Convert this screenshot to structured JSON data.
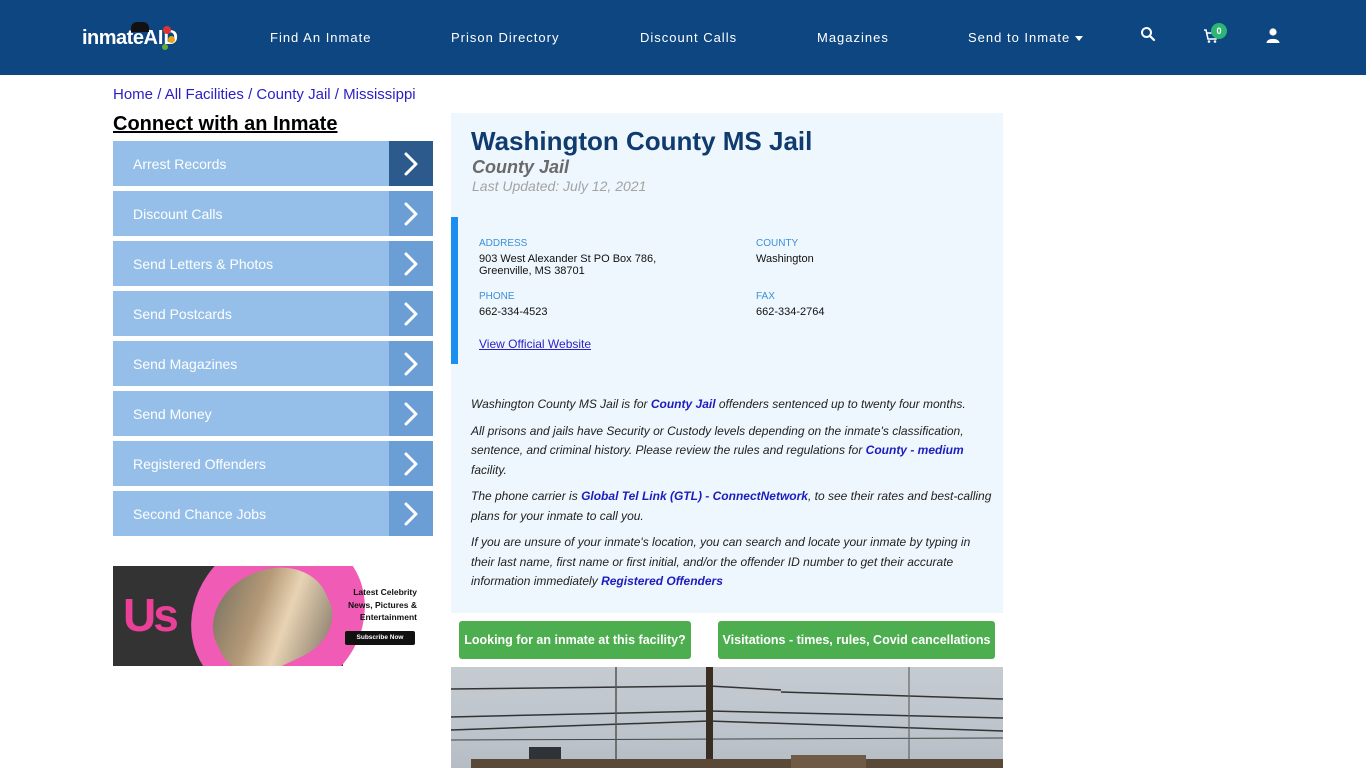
{
  "header": {
    "logo_text": "inmate",
    "logo_aid": "AID",
    "nav": [
      {
        "label": "Find An Inmate"
      },
      {
        "label": "Prison Directory"
      },
      {
        "label": "Discount Calls"
      },
      {
        "label": "Magazines"
      },
      {
        "label": "Send to Inmate",
        "dropdown": true
      }
    ],
    "icons": [
      "search-icon",
      "cart-icon",
      "user-icon"
    ],
    "cart_count": "0"
  },
  "breadcrumb": {
    "items": [
      "Home",
      "All Facilities",
      "County Jail",
      "Mississippi"
    ],
    "separator": "/"
  },
  "sidebar": {
    "title": "Connect with an Inmate",
    "items": [
      {
        "label": "Arrest Records"
      },
      {
        "label": "Discount Calls"
      },
      {
        "label": "Send Letters & Photos"
      },
      {
        "label": "Send Postcards"
      },
      {
        "label": "Send Magazines"
      },
      {
        "label": "Send Money"
      },
      {
        "label": "Registered Offenders"
      },
      {
        "label": "Second Chance Jobs"
      }
    ],
    "ad": {
      "brand": "Us",
      "line1": "Latest Celebrity",
      "line2": "News, Pictures &",
      "line3": "Entertainment",
      "button": "Subscribe Now"
    }
  },
  "facility": {
    "name": "Washington County MS Jail",
    "type": "County Jail",
    "last_updated": "Last Updated: July 12, 2021",
    "address_label": "ADDRESS",
    "address_line1": "903 West Alexander St PO Box 786,",
    "address_line2": "Greenville, MS 38701",
    "county_label": "COUNTY",
    "county": "Washington",
    "phone_label": "PHONE",
    "phone": "662-334-4523",
    "fax_label": "FAX",
    "fax": "662-334-2764",
    "website_link": "View Official Website"
  },
  "description": {
    "p1_pre": "Washington County MS Jail is for ",
    "p1_link": "County Jail",
    "p1_post": " offenders sentenced up to twenty four months.",
    "p2_pre": "All prisons and jails have Security or Custody levels depending on the inmate's classification, sentence, and criminal history. Please review the rules and regulations for ",
    "p2_link": "County - medium",
    "p2_post": " facility.",
    "p3_pre": "The phone carrier is ",
    "p3_link": "Global Tel Link (GTL) - ConnectNetwork",
    "p3_post": ", to see their rates and best-calling plans for your inmate to call you.",
    "p4_pre": "If you are unsure of your inmate's location, you can search and locate your inmate by typing in their last name, first name or first initial, and/or the offender ID number to get their accurate information immediately ",
    "p4_link": "Registered Offenders"
  },
  "actions": {
    "find_inmate": "Looking for an inmate at this facility?",
    "visitations": "Visitations - times, rules, Covid cancellations"
  }
}
